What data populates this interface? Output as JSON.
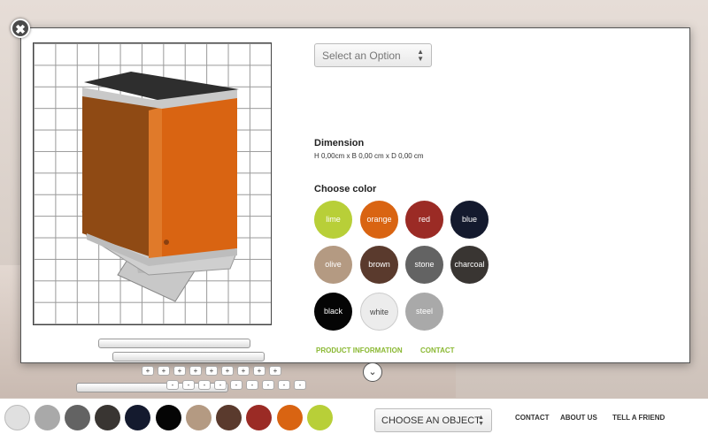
{
  "select": {
    "placeholder": "Select an Option",
    "arrows": "▲\n▼"
  },
  "dimension": {
    "title": "Dimension",
    "value": "H 0,00cm x B 0,00 cm x D 0,00 cm"
  },
  "colors": {
    "title": "Choose color",
    "items": [
      {
        "label": "lime",
        "hex": "#b8cf38"
      },
      {
        "label": "orange",
        "hex": "#d96412"
      },
      {
        "label": "red",
        "hex": "#9b2b25"
      },
      {
        "label": "blue",
        "hex": "#141a2e"
      },
      {
        "label": "olive",
        "hex": "#b49a82"
      },
      {
        "label": "brown",
        "hex": "#5a3a2d"
      },
      {
        "label": "stone",
        "hex": "#636363"
      },
      {
        "label": "charcoal",
        "hex": "#393532"
      },
      {
        "label": "black",
        "hex": "#050505"
      },
      {
        "label": "white",
        "hex": "#ececec"
      },
      {
        "label": "steel",
        "hex": "#a9a9a9"
      }
    ]
  },
  "links": {
    "product_info": "PRODUCT INFORMATION",
    "contact": "CONTACT"
  },
  "sliders": {
    "plus": "+",
    "minus": "-"
  },
  "bottom": {
    "swatches": [
      "#e0e0e0",
      "#a9a9a9",
      "#636363",
      "#393532",
      "#141a2e",
      "#050505",
      "#b49a82",
      "#5a3a2d",
      "#9b2b25",
      "#d96412",
      "#b8cf38"
    ],
    "choose_object": "CHOOSE AN OBJECT",
    "arrows": "▲\n▼",
    "nav": {
      "contact": "CONTACT",
      "about": "ABOUT US",
      "tell": "TELL A FRIEND"
    }
  },
  "icons": {
    "close": "✖",
    "scroll_down": "⌄"
  }
}
